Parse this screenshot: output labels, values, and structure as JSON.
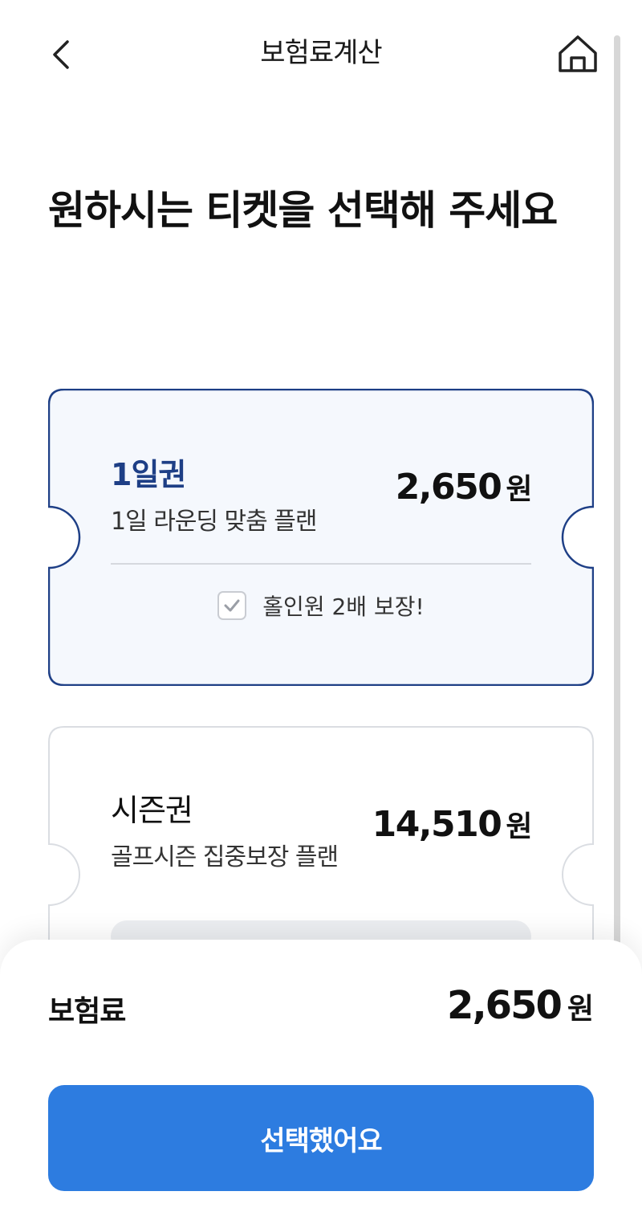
{
  "header": {
    "title": "보험료계산",
    "back_icon": "chevron-left-icon",
    "home_icon": "home-icon"
  },
  "page_title": "원하시는 티켓을 선택해 주세요",
  "tickets": [
    {
      "name": "1일권",
      "description": "1일 라운딩 맞춤 플랜",
      "price": "2,650",
      "currency": "원",
      "benefit": "홀인원 2배 보장!",
      "selected": true
    },
    {
      "name": "시즌권",
      "description": "골프시즌 집중보장 플랜",
      "price": "14,510",
      "currency": "원",
      "selected": false
    }
  ],
  "summary": {
    "label": "보험료",
    "amount": "2,650",
    "currency": "원"
  },
  "cta_label": "선택했어요",
  "colors": {
    "accent": "#2D7CE0",
    "selected_border": "#1E3F86",
    "selected_fill": "#F5F8FD",
    "selected_title": "#1E3F86",
    "card_border": "#DADDE2"
  }
}
